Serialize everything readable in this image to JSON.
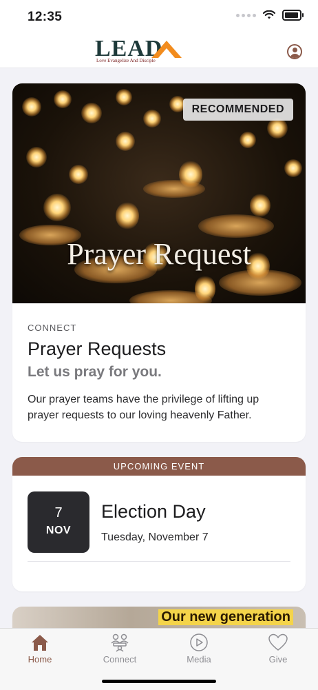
{
  "status_bar": {
    "time": "12:35"
  },
  "header": {
    "logo": {
      "word": "LEAD",
      "tagline": "Love  Evangelize  And  Disciple"
    },
    "profile_icon": "person-circle-icon"
  },
  "featured": {
    "badge": "RECOMMENDED",
    "image_title": "Prayer Request",
    "kicker": "CONNECT",
    "title": "Prayer Requests",
    "subtitle": "Let us pray for you.",
    "description": "Our prayer teams have the privilege of lifting up prayer requests to our loving heavenly Father."
  },
  "event": {
    "band_label": "UPCOMING EVENT",
    "day": "7",
    "month": "NOV",
    "title": "Election Day",
    "date_text": "Tuesday, November 7"
  },
  "next_card": {
    "image_text": "Our new generation"
  },
  "tab_bar": {
    "tabs": [
      {
        "label": "Home",
        "icon": "home-icon",
        "active": true
      },
      {
        "label": "Connect",
        "icon": "connect-people-icon",
        "active": false
      },
      {
        "label": "Media",
        "icon": "play-circle-icon",
        "active": false
      },
      {
        "label": "Give",
        "icon": "heart-icon",
        "active": false
      }
    ]
  },
  "colors": {
    "accent": "#8b5a4a",
    "inactive": "#8e8e93",
    "background": "#f2f2f7",
    "date_box": "#2a2a2e"
  }
}
